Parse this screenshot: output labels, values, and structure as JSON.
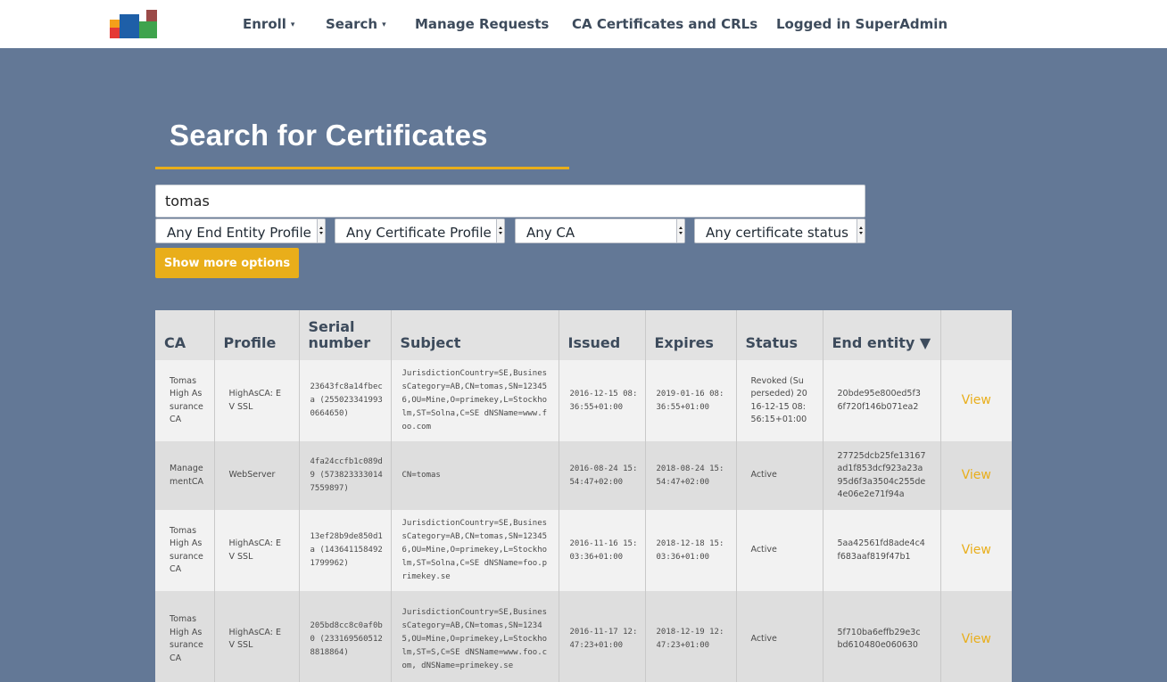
{
  "logo": {
    "colors": [
      "#e53935",
      "#f4a01a",
      "#1e5fa8",
      "#3fa34d",
      "#9b4a48"
    ]
  },
  "nav": {
    "enroll": "Enroll",
    "search": "Search",
    "manage_requests": "Manage Requests",
    "ca_certs": "CA Certificates and CRLs",
    "logged_in": "Logged in SuperAdmin",
    "caret": "▾"
  },
  "page": {
    "title": "Search for Certificates"
  },
  "search": {
    "value": "tomas"
  },
  "filters": {
    "end_entity_profile": "Any End Entity Profile",
    "certificate_profile": "Any Certificate Profile",
    "ca": "Any CA",
    "status": "Any certificate status"
  },
  "buttons": {
    "show_more": "Show more options"
  },
  "table": {
    "headers": {
      "ca": "CA",
      "profile": "Profile",
      "serial": "Serial number",
      "subject": "Subject",
      "issued": "Issued",
      "expires": "Expires",
      "status": "Status",
      "end_entity": "End entity ▼"
    },
    "rows": [
      {
        "ca": "Tomas High Assurance CA",
        "profile": "HighAsCA: EV SSL",
        "serial": "23643fc8a14fbeca (2550233419930664650)",
        "subject": "JurisdictionCountry=SE,BusinessCategory=AB,CN=tomas,SN=123456,OU=Mine,O=primekey,L=Stockholm,ST=Solna,C=SE dNSName=www.foo.com",
        "issued": "2016-12-15 08:36:55+01:00",
        "expires": "2019-01-16 08:36:55+01:00",
        "status": "Revoked (Superseded) 2016-12-15 08:56:15+01:00",
        "end_entity": "20bde95e800ed5f36f720f146b071ea2",
        "view": "View"
      },
      {
        "ca": "ManagementCA",
        "profile": "WebServer",
        "serial": "4fa24ccfb1c089d9 (5738233330147559897)",
        "subject": "CN=tomas",
        "issued": "2016-08-24 15:54:47+02:00",
        "expires": "2018-08-24 15:54:47+02:00",
        "status": "Active",
        "end_entity": "27725dcb25fe13167ad1f853dcf923a23a95d6f3a3504c255de4e06e2e71f94a",
        "view": "View"
      },
      {
        "ca": "Tomas High Assurance CA",
        "profile": "HighAsCA: EV SSL",
        "serial": "13ef28b9de850d1a (1436411584921799962)",
        "subject": "JurisdictionCountry=SE,BusinessCategory=AB,CN=tomas,SN=123456,OU=Mine,O=primekey,L=Stockholm,ST=Solna,C=SE dNSName=foo.primekey.se",
        "issued": "2016-11-16 15:03:36+01:00",
        "expires": "2018-12-18 15:03:36+01:00",
        "status": "Active",
        "end_entity": "5aa42561fd8ade4c4f683aaf819f47b1",
        "view": "View"
      },
      {
        "ca": "Tomas High Assurance CA",
        "profile": "HighAsCA: EV SSL",
        "serial": "205bd8cc8c0af0b0 (2331695605128818864)",
        "subject": "JurisdictionCountry=SE,BusinessCategory=AB,CN=tomas,SN=12345,OU=Mine,O=primekey,L=Stockholm,ST=S,C=SE dNSName=www.foo.com, dNSName=primekey.se",
        "issued": "2016-11-17 12:47:23+01:00",
        "expires": "2018-12-19 12:47:23+01:00",
        "status": "Active",
        "end_entity": "5f710ba6effb29e3cbd610480e060630",
        "view": "View"
      }
    ]
  }
}
